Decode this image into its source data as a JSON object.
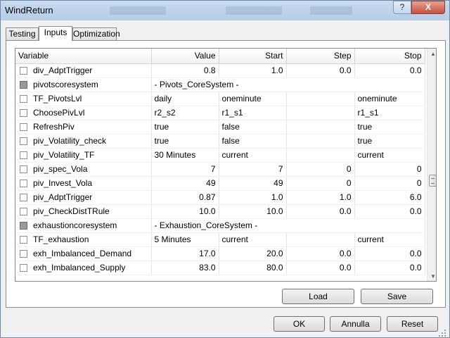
{
  "window": {
    "title": "WindReturn"
  },
  "titlebar": {
    "help_label": "?",
    "close_label": "X",
    "background_items": [
      "New Order",
      "AutoTrading"
    ]
  },
  "tabs": [
    {
      "label": "Testing",
      "active": false
    },
    {
      "label": "Inputs",
      "active": true
    },
    {
      "label": "Optimization",
      "active": false
    }
  ],
  "grid": {
    "columns": [
      "Variable",
      "Value",
      "Start",
      "Step",
      "Stop"
    ],
    "rows": [
      {
        "name": "div_AdptTrigger",
        "kind": "num",
        "value": "0.8",
        "start": "1.0",
        "step": "0.0",
        "stop": "0.0"
      },
      {
        "name": "pivotscoresystem",
        "kind": "section",
        "value": "- Pivots_CoreSystem -"
      },
      {
        "name": "TF_PivotsLvl",
        "kind": "enum",
        "value": "daily",
        "start": "oneminute",
        "step": "",
        "stop": "oneminute"
      },
      {
        "name": "ChoosePivLvl",
        "kind": "enum",
        "value": "r2_s2",
        "start": "r1_s1",
        "step": "",
        "stop": "r1_s1"
      },
      {
        "name": "RefreshPiv",
        "kind": "enum",
        "value": "true",
        "start": "false",
        "step": "",
        "stop": "true"
      },
      {
        "name": "piv_Volatility_check",
        "kind": "enum",
        "value": "true",
        "start": "false",
        "step": "",
        "stop": "true"
      },
      {
        "name": "piv_Volatility_TF",
        "kind": "enum",
        "value": "30 Minutes",
        "start": "current",
        "step": "",
        "stop": "current"
      },
      {
        "name": "piv_spec_Vola",
        "kind": "num",
        "value": "7",
        "start": "7",
        "step": "0",
        "stop": "0"
      },
      {
        "name": "piv_Invest_Vola",
        "kind": "num",
        "value": "49",
        "start": "49",
        "step": "0",
        "stop": "0"
      },
      {
        "name": "piv_AdptTrigger",
        "kind": "num",
        "value": "0.87",
        "start": "1.0",
        "step": "1.0",
        "stop": "6.0"
      },
      {
        "name": "piv_CheckDistTRule",
        "kind": "num",
        "value": "10.0",
        "start": "10.0",
        "step": "0.0",
        "stop": "0.0"
      },
      {
        "name": "exhaustioncoresystem",
        "kind": "section",
        "value": "- Exhaustion_CoreSystem -"
      },
      {
        "name": "TF_exhaustion",
        "kind": "enum",
        "value": "5 Minutes",
        "start": "current",
        "step": "",
        "stop": "current"
      },
      {
        "name": "exh_Imbalanced_Demand",
        "kind": "num",
        "value": "17.0",
        "start": "20.0",
        "step": "0.0",
        "stop": "0.0"
      },
      {
        "name": "exh_Imbalanced_Supply",
        "kind": "num",
        "value": "83.0",
        "start": "80.0",
        "step": "0.0",
        "stop": "0.0"
      }
    ]
  },
  "buttons": {
    "load": "Load",
    "save": "Save",
    "ok": "OK",
    "cancel": "Annulla",
    "reset": "Reset"
  },
  "colors": {
    "titlebar": "#b6cde6",
    "window_bg": "#f0f0f0",
    "section_checkbox": "#9a9a9a"
  }
}
